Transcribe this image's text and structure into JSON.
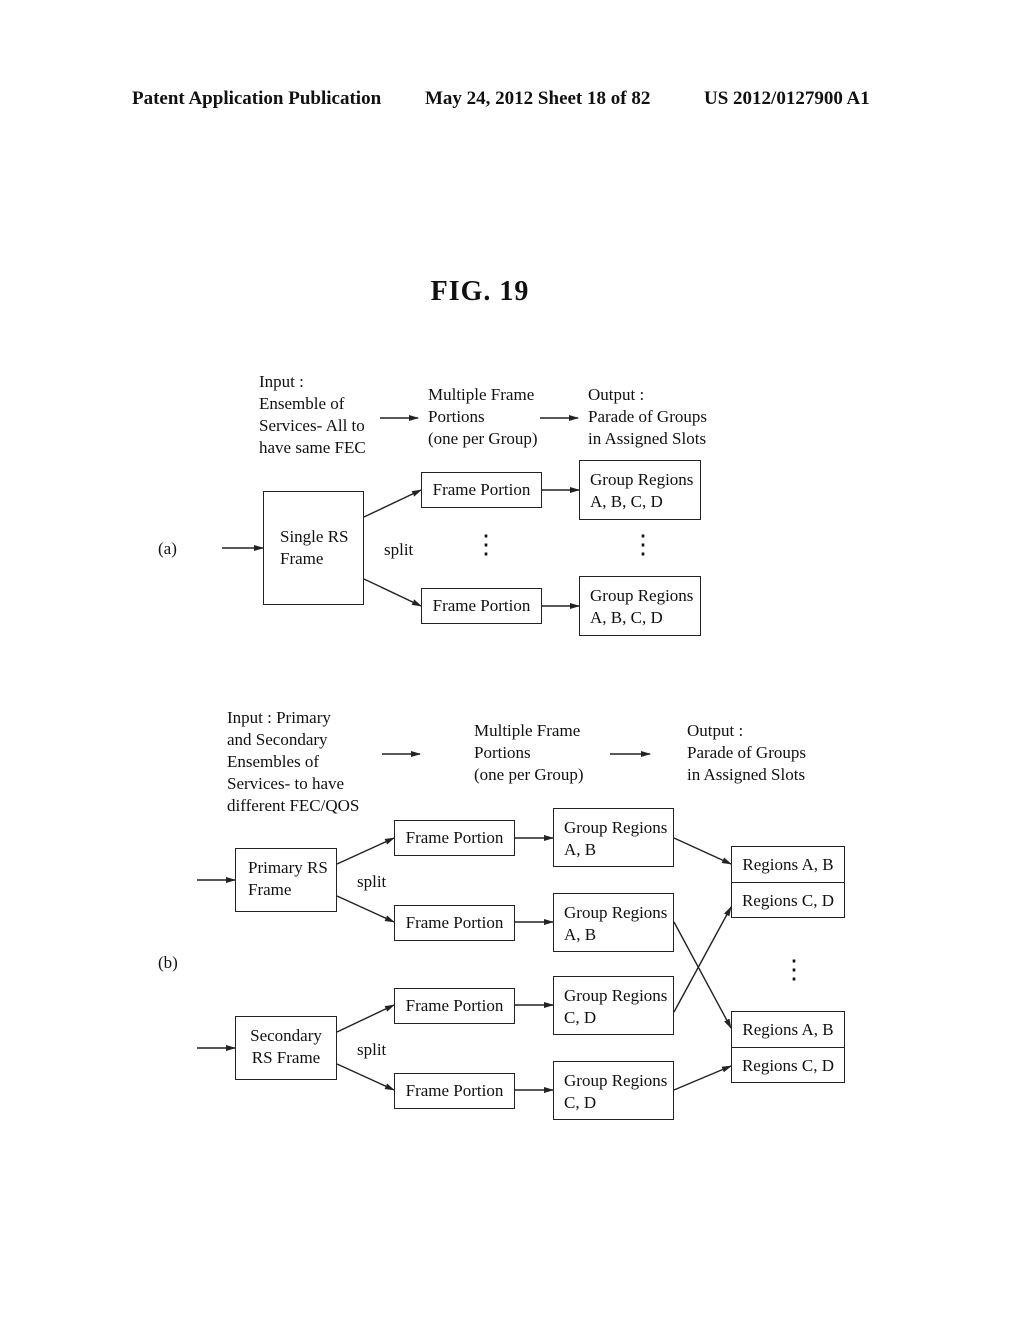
{
  "header": {
    "left": "Patent Application Publication",
    "middle": "May 24, 2012  Sheet 18 of 82",
    "right": "US 2012/0127900 A1"
  },
  "figure_title": "FIG. 19",
  "part_a": {
    "label": "(a)",
    "input_text": "Input :\nEnsemble of\nServices- All to\nhave same FEC",
    "middle_text": "Multiple Frame\nPortions\n(one per Group)",
    "output_text": "Output :\nParade of Groups\nin Assigned Slots",
    "source_box": "Single RS\nFrame",
    "split_label": "split",
    "frame_portion_1": "Frame Portion",
    "frame_portion_2": "Frame Portion",
    "group_regions_1": "Group Regions\nA, B, C, D",
    "group_regions_2": "Group Regions\nA, B, C, D",
    "ellipsis": "⋮"
  },
  "part_b": {
    "label": "(b)",
    "input_text": "Input : Primary\nand Secondary\nEnsembles of\nServices- to have\ndifferent FEC/QOS",
    "middle_text": "Multiple Frame\nPortions\n(one per Group)",
    "output_text": "Output :\nParade of Groups\nin Assigned Slots",
    "primary_box": "Primary RS\nFrame",
    "secondary_box": "Secondary\nRS Frame",
    "split_label_1": "split",
    "split_label_2": "split",
    "frame_portions": [
      "Frame Portion",
      "Frame Portion",
      "Frame Portion",
      "Frame Portion"
    ],
    "group_regions": [
      "Group Regions\nA, B",
      "Group Regions\nA, B",
      "Group Regions\nC, D",
      "Group Regions\nC, D"
    ],
    "slot_1": [
      "Regions A, B",
      "Regions C, D"
    ],
    "slot_2": [
      "Regions A, B",
      "Regions C, D"
    ],
    "ellipsis": "⋮"
  }
}
